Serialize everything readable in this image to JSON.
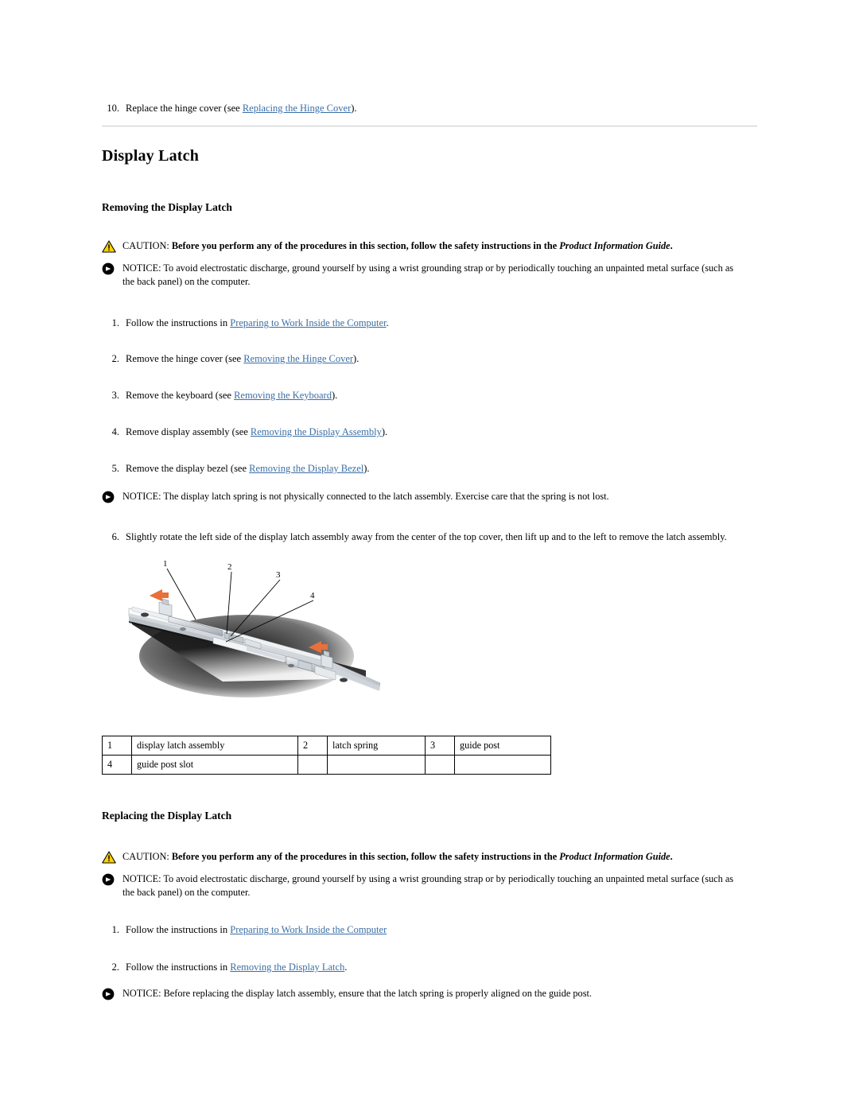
{
  "document": {
    "title": "Display Latch"
  },
  "top_step": {
    "number": "10.",
    "prefix": "Replace the hinge cover (see ",
    "link": "Replacing the Hinge Cover",
    "suffix": ")."
  },
  "removing": {
    "heading": "Removing the Display Latch",
    "caution": {
      "icon": "warning-triangle-icon",
      "label": "CAUTION: ",
      "text_before_italic": "Before you perform any of the procedures in this section, follow the safety instructions in the ",
      "italic": "Product Information Guide",
      "text_after_italic": "."
    },
    "notice_top": {
      "icon": "notice-arrow-icon",
      "text": "NOTICE: To avoid electrostatic discharge, ground yourself by using a wrist grounding strap or by periodically touching an unpainted metal surface (such as the back panel) on the computer."
    },
    "steps": [
      {
        "number": "1.",
        "prefix": "Follow the instructions in ",
        "link": "Preparing to Work Inside the Computer",
        "suffix": "."
      },
      {
        "number": "2.",
        "prefix": "Remove the hinge cover (see ",
        "link": "Removing the Hinge Cover",
        "suffix": ")."
      },
      {
        "number": "3.",
        "prefix": "Remove the keyboard (see ",
        "link": "Removing the Keyboard",
        "suffix": ")."
      },
      {
        "number": "4.",
        "prefix": "Remove display assembly (see ",
        "link": "Removing the Display Assembly",
        "suffix": ")."
      },
      {
        "number": "5.",
        "prefix": "Remove the display bezel (see ",
        "link": "Removing the Display Bezel",
        "suffix": ")."
      }
    ],
    "notice_spring": {
      "icon": "notice-arrow-icon",
      "text": "NOTICE: The display latch spring is not physically connected to the latch assembly. Exercise care that the spring is not lost."
    },
    "step6": {
      "number": "6.",
      "text": "Slightly rotate the left side of the display latch assembly away from the center of the top cover, then lift up and to the left to remove the latch assembly."
    }
  },
  "figure": {
    "alt": "Display latch assembly on laptop top cover with callouts",
    "callouts": [
      "1",
      "2",
      "3",
      "4"
    ],
    "arrow_color": "#E8703A"
  },
  "legend_table": {
    "rows": [
      [
        {
          "index": "1",
          "label": "display latch assembly"
        },
        {
          "index": "2",
          "label": "latch spring"
        },
        {
          "index": "3",
          "label": "guide post"
        }
      ],
      [
        {
          "index": "4",
          "label": "guide post slot"
        },
        {
          "index": "",
          "label": ""
        },
        {
          "index": "",
          "label": ""
        }
      ]
    ]
  },
  "replacing": {
    "heading": "Replacing the Display Latch",
    "caution": {
      "icon": "warning-triangle-icon",
      "label": "CAUTION: ",
      "text_before_italic": "Before you perform any of the procedures in this section, follow the safety instructions in the ",
      "italic": "Product Information Guide",
      "text_after_italic": "."
    },
    "notice_top": {
      "icon": "notice-arrow-icon",
      "text": "NOTICE: To avoid electrostatic discharge, ground yourself by using a wrist grounding strap or by periodically touching an unpainted metal surface (such as the back panel) on the computer."
    },
    "steps": [
      {
        "number": "1.",
        "prefix": "Follow the instructions in ",
        "link": "Preparing to Work Inside the Computer",
        "suffix": ""
      },
      {
        "number": "2.",
        "prefix": "Follow the instructions in ",
        "link": "Removing the Display Latch",
        "suffix": "."
      }
    ],
    "notice_bottom": {
      "icon": "notice-arrow-icon",
      "text": "NOTICE: Before replacing the display latch assembly, ensure that the latch spring is properly aligned on the guide post."
    }
  },
  "colors": {
    "link": "#3a6ea5",
    "rule": "#c8c8c8",
    "caution_icon_fill": "#FFD200",
    "notice_icon_fill": "#000000"
  }
}
